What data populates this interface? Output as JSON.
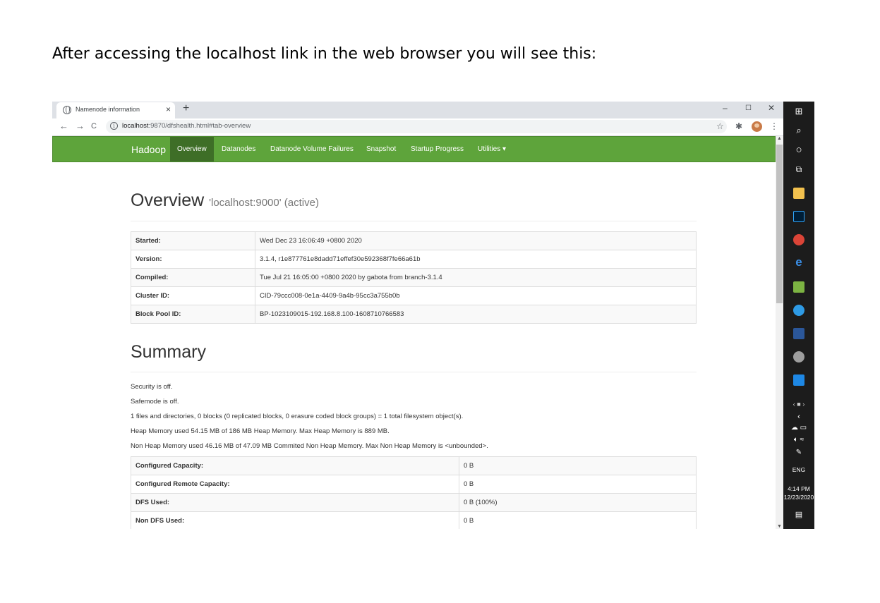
{
  "caption": "After accessing the localhost link in the web browser you will see this:",
  "browser": {
    "tab_title": "Namenode information",
    "tab_close": "×",
    "new_tab": "+",
    "window_controls": [
      "–",
      "☐",
      "✕"
    ],
    "url_host": "localhost",
    "url_path": ":9870/dfshealth.html#tab-overview",
    "back": "←",
    "forward": "→",
    "reload": "C"
  },
  "navbar": {
    "brand": "Hadoop",
    "items": [
      "Overview",
      "Datanodes",
      "Datanode Volume Failures",
      "Snapshot",
      "Startup Progress",
      "Utilities ▾"
    ],
    "active": "Overview",
    "color": "#5ea43b"
  },
  "overview": {
    "title": "Overview",
    "subtitle": "'localhost:9000' (active)",
    "rows": [
      {
        "key": "Started:",
        "value": "Wed Dec 23 16:06:49 +0800 2020"
      },
      {
        "key": "Version:",
        "value": "3.1.4, r1e877761e8dadd71effef30e592368f7fe66a61b"
      },
      {
        "key": "Compiled:",
        "value": "Tue Jul 21 16:05:00 +0800 2020 by gabota from branch-3.1.4"
      },
      {
        "key": "Cluster ID:",
        "value": "CID-79ccc008-0e1a-4409-9a4b-95cc3a755b0b"
      },
      {
        "key": "Block Pool ID:",
        "value": "BP-1023109015-192.168.8.100-1608710766583"
      }
    ]
  },
  "summary": {
    "title": "Summary",
    "lines": [
      "Security is off.",
      "Safemode is off.",
      "1 files and directories, 0 blocks (0 replicated blocks, 0 erasure coded block groups) = 1 total filesystem object(s).",
      "Heap Memory used 54.15 MB of 186 MB Heap Memory. Max Heap Memory is 889 MB.",
      "Non Heap Memory used 46.16 MB of 47.09 MB Commited Non Heap Memory. Max Non Heap Memory is <unbounded>."
    ],
    "rows": [
      {
        "key": "Configured Capacity:",
        "value": "0 B"
      },
      {
        "key": "Configured Remote Capacity:",
        "value": "0 B"
      },
      {
        "key": "DFS Used:",
        "value": "0 B (100%)"
      },
      {
        "key": "Non DFS Used:",
        "value": "0 B"
      }
    ]
  },
  "taskbar": {
    "language": "ENG",
    "time": "4:14 PM",
    "date": "12/23/2020"
  }
}
